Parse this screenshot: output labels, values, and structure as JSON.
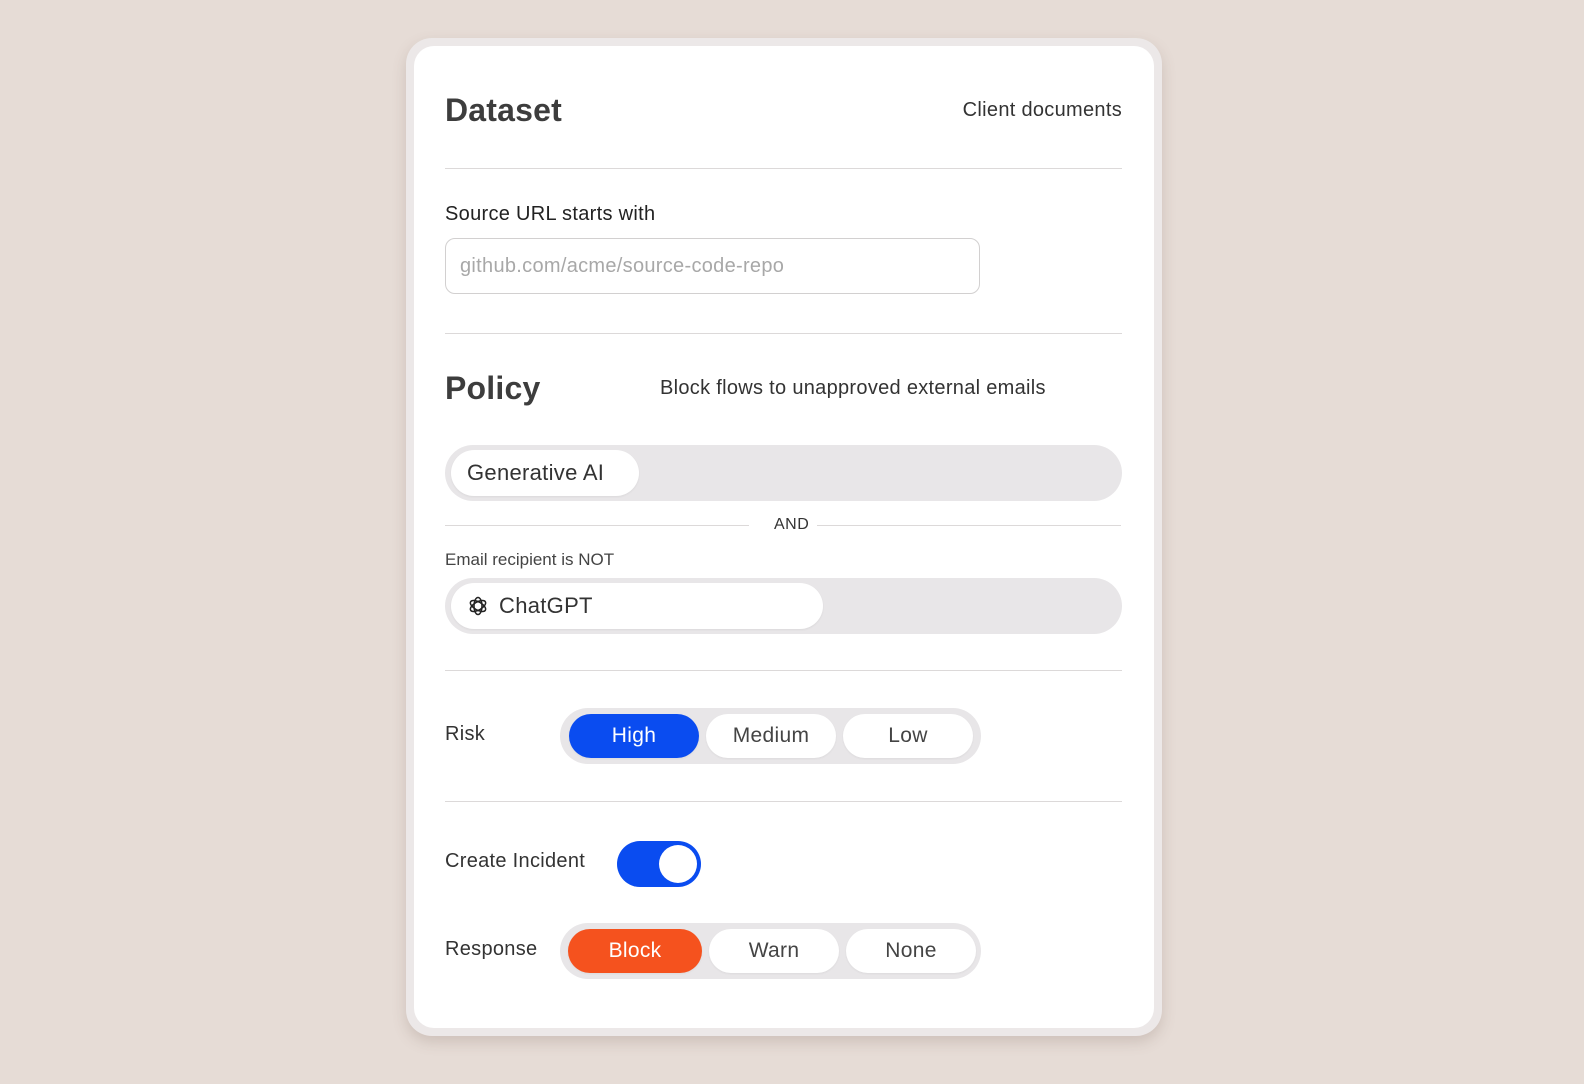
{
  "dataset": {
    "title": "Dataset",
    "value": "Client documents"
  },
  "source_url": {
    "label": "Source URL starts with",
    "placeholder": "github.com/acme/source-code-repo",
    "value": ""
  },
  "policy": {
    "title": "Policy",
    "description": "Block flows to unapproved external emails",
    "condition_1": "Generative AI",
    "operator": "AND",
    "condition_2_label": "Email recipient is NOT",
    "condition_2_value": "ChatGPT",
    "condition_2_icon": "openai-icon"
  },
  "risk": {
    "label": "Risk",
    "options": [
      "High",
      "Medium",
      "Low"
    ],
    "selected": "High",
    "accent": "#0a4cf0"
  },
  "incident": {
    "label": "Create Incident",
    "enabled": true,
    "accent": "#0a4cf0"
  },
  "response": {
    "label": "Response",
    "options": [
      "Block",
      "Warn",
      "None"
    ],
    "selected": "Block",
    "accent": "#f5521e"
  }
}
